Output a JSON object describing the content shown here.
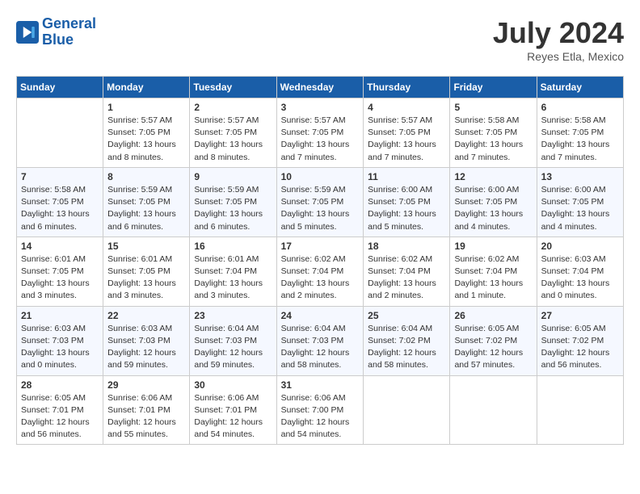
{
  "header": {
    "logo_line1": "General",
    "logo_line2": "Blue",
    "month_year": "July 2024",
    "location": "Reyes Etla, Mexico"
  },
  "days_of_week": [
    "Sunday",
    "Monday",
    "Tuesday",
    "Wednesday",
    "Thursday",
    "Friday",
    "Saturday"
  ],
  "weeks": [
    [
      {
        "num": "",
        "info": ""
      },
      {
        "num": "1",
        "info": "Sunrise: 5:57 AM\nSunset: 7:05 PM\nDaylight: 13 hours\nand 8 minutes."
      },
      {
        "num": "2",
        "info": "Sunrise: 5:57 AM\nSunset: 7:05 PM\nDaylight: 13 hours\nand 8 minutes."
      },
      {
        "num": "3",
        "info": "Sunrise: 5:57 AM\nSunset: 7:05 PM\nDaylight: 13 hours\nand 7 minutes."
      },
      {
        "num": "4",
        "info": "Sunrise: 5:57 AM\nSunset: 7:05 PM\nDaylight: 13 hours\nand 7 minutes."
      },
      {
        "num": "5",
        "info": "Sunrise: 5:58 AM\nSunset: 7:05 PM\nDaylight: 13 hours\nand 7 minutes."
      },
      {
        "num": "6",
        "info": "Sunrise: 5:58 AM\nSunset: 7:05 PM\nDaylight: 13 hours\nand 7 minutes."
      }
    ],
    [
      {
        "num": "7",
        "info": "Sunrise: 5:58 AM\nSunset: 7:05 PM\nDaylight: 13 hours\nand 6 minutes."
      },
      {
        "num": "8",
        "info": "Sunrise: 5:59 AM\nSunset: 7:05 PM\nDaylight: 13 hours\nand 6 minutes."
      },
      {
        "num": "9",
        "info": "Sunrise: 5:59 AM\nSunset: 7:05 PM\nDaylight: 13 hours\nand 6 minutes."
      },
      {
        "num": "10",
        "info": "Sunrise: 5:59 AM\nSunset: 7:05 PM\nDaylight: 13 hours\nand 5 minutes."
      },
      {
        "num": "11",
        "info": "Sunrise: 6:00 AM\nSunset: 7:05 PM\nDaylight: 13 hours\nand 5 minutes."
      },
      {
        "num": "12",
        "info": "Sunrise: 6:00 AM\nSunset: 7:05 PM\nDaylight: 13 hours\nand 4 minutes."
      },
      {
        "num": "13",
        "info": "Sunrise: 6:00 AM\nSunset: 7:05 PM\nDaylight: 13 hours\nand 4 minutes."
      }
    ],
    [
      {
        "num": "14",
        "info": "Sunrise: 6:01 AM\nSunset: 7:05 PM\nDaylight: 13 hours\nand 3 minutes."
      },
      {
        "num": "15",
        "info": "Sunrise: 6:01 AM\nSunset: 7:05 PM\nDaylight: 13 hours\nand 3 minutes."
      },
      {
        "num": "16",
        "info": "Sunrise: 6:01 AM\nSunset: 7:04 PM\nDaylight: 13 hours\nand 3 minutes."
      },
      {
        "num": "17",
        "info": "Sunrise: 6:02 AM\nSunset: 7:04 PM\nDaylight: 13 hours\nand 2 minutes."
      },
      {
        "num": "18",
        "info": "Sunrise: 6:02 AM\nSunset: 7:04 PM\nDaylight: 13 hours\nand 2 minutes."
      },
      {
        "num": "19",
        "info": "Sunrise: 6:02 AM\nSunset: 7:04 PM\nDaylight: 13 hours\nand 1 minute."
      },
      {
        "num": "20",
        "info": "Sunrise: 6:03 AM\nSunset: 7:04 PM\nDaylight: 13 hours\nand 0 minutes."
      }
    ],
    [
      {
        "num": "21",
        "info": "Sunrise: 6:03 AM\nSunset: 7:03 PM\nDaylight: 13 hours\nand 0 minutes."
      },
      {
        "num": "22",
        "info": "Sunrise: 6:03 AM\nSunset: 7:03 PM\nDaylight: 12 hours\nand 59 minutes."
      },
      {
        "num": "23",
        "info": "Sunrise: 6:04 AM\nSunset: 7:03 PM\nDaylight: 12 hours\nand 59 minutes."
      },
      {
        "num": "24",
        "info": "Sunrise: 6:04 AM\nSunset: 7:03 PM\nDaylight: 12 hours\nand 58 minutes."
      },
      {
        "num": "25",
        "info": "Sunrise: 6:04 AM\nSunset: 7:02 PM\nDaylight: 12 hours\nand 58 minutes."
      },
      {
        "num": "26",
        "info": "Sunrise: 6:05 AM\nSunset: 7:02 PM\nDaylight: 12 hours\nand 57 minutes."
      },
      {
        "num": "27",
        "info": "Sunrise: 6:05 AM\nSunset: 7:02 PM\nDaylight: 12 hours\nand 56 minutes."
      }
    ],
    [
      {
        "num": "28",
        "info": "Sunrise: 6:05 AM\nSunset: 7:01 PM\nDaylight: 12 hours\nand 56 minutes."
      },
      {
        "num": "29",
        "info": "Sunrise: 6:06 AM\nSunset: 7:01 PM\nDaylight: 12 hours\nand 55 minutes."
      },
      {
        "num": "30",
        "info": "Sunrise: 6:06 AM\nSunset: 7:01 PM\nDaylight: 12 hours\nand 54 minutes."
      },
      {
        "num": "31",
        "info": "Sunrise: 6:06 AM\nSunset: 7:00 PM\nDaylight: 12 hours\nand 54 minutes."
      },
      {
        "num": "",
        "info": ""
      },
      {
        "num": "",
        "info": ""
      },
      {
        "num": "",
        "info": ""
      }
    ]
  ]
}
